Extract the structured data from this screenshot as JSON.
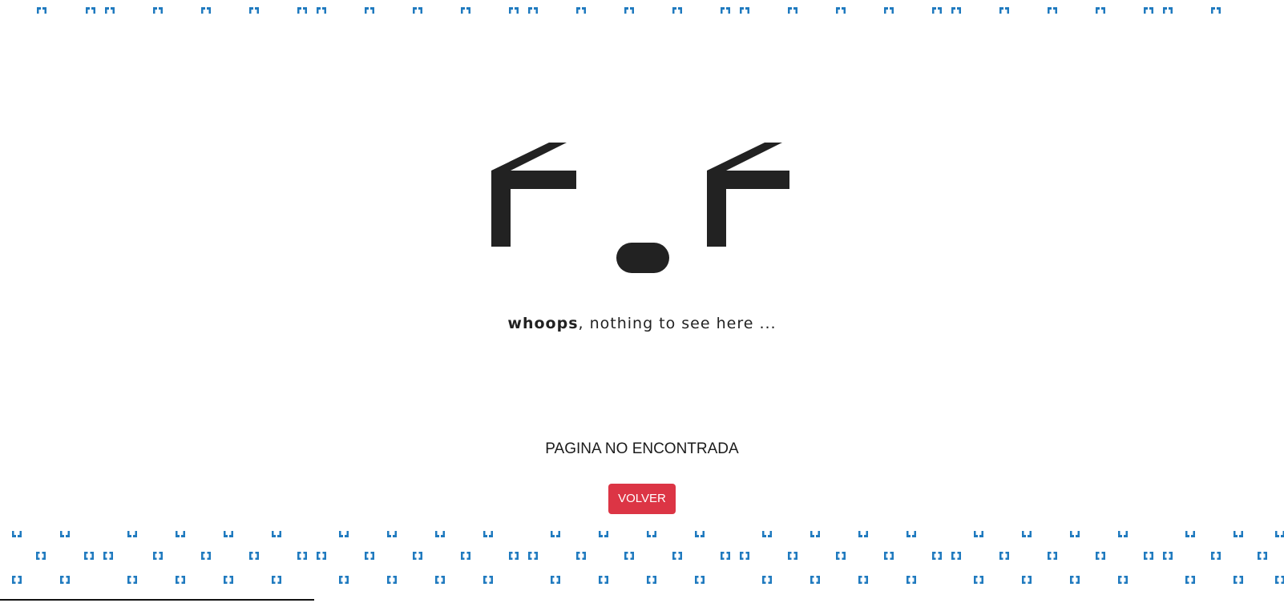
{
  "main": {
    "whoops_bold": "whoops",
    "whoops_rest": ", nothing to see here ...",
    "not_found": "PAGINA NO ENCONTRADA",
    "back_button_label": "VOLVER"
  },
  "colors": {
    "pattern": "#1f7abf",
    "face": "#222222",
    "button": "#dc3545"
  },
  "icons": {
    "face": "sad-face-icon",
    "pattern_tile": "bracket-square-icon"
  }
}
